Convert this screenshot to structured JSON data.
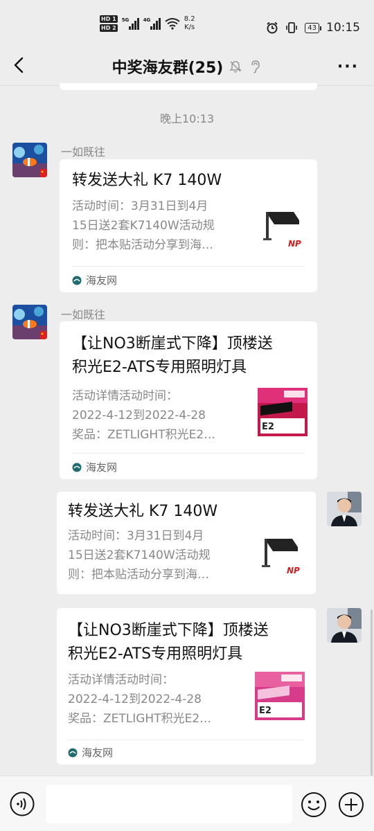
{
  "status_bar": {
    "hd1": "HD 1",
    "hd2": "HD 2",
    "net1": "5G",
    "net2": "4G",
    "speed_value": "8.2",
    "speed_unit": "K/s",
    "battery": "43",
    "time": "10:15"
  },
  "header": {
    "title": "中奖海友群(25)",
    "back_icon": "chevron-left-icon",
    "mute_icon": "bell-off-icon",
    "ear_icon": "earpiece-icon",
    "more_label": "···"
  },
  "timestamp": "晚上10:13",
  "messages": [
    {
      "sender": "一如既往",
      "side": "left",
      "title_lines": [
        "转发送大礼 K7 140W"
      ],
      "desc_lines": [
        "活动时间：3月31日到4月",
        "15日送2套K7140W活动规",
        "则：把本贴活动分享到海…"
      ],
      "thumb": "light-fixture",
      "thumb_text": "NP",
      "source": "海友网"
    },
    {
      "sender": "一如既往",
      "side": "left",
      "title_lines": [
        "【让NO3断崖式下降】顶楼送",
        "积光E2-ATS专用照明灯具"
      ],
      "desc_lines": [
        "活动详情活动时间：",
        "2022-4-12到2022-4-28",
        "奖品：ZETLIGHT积光E2…"
      ],
      "thumb": "e2-box",
      "thumb_text": "E2",
      "source": "海友网"
    },
    {
      "sender": "",
      "side": "right",
      "title_lines": [
        "转发送大礼 K7 140W"
      ],
      "desc_lines": [
        "活动时间：3月31日到4月",
        "15日送2套K7140W活动规",
        "则：把本贴活动分享到海…"
      ],
      "thumb": "light-fixture",
      "thumb_text": "NP",
      "source": ""
    },
    {
      "sender": "",
      "side": "right",
      "title_lines": [
        "【让NO3断崖式下降】顶楼送",
        "积光E2-ATS专用照明灯具"
      ],
      "desc_lines": [
        "活动详情活动时间：",
        "2022-4-12到2022-4-28",
        "奖品：ZETLIGHT积光E2…"
      ],
      "thumb": "e2-box",
      "thumb_text": "E2",
      "source": "海友网"
    }
  ],
  "bottom_bar": {
    "voice_icon": "voice-icon",
    "emoji_icon": "emoji-icon",
    "plus_icon": "plus-icon",
    "input_value": ""
  },
  "colors": {
    "background": "#ededed",
    "bubble": "#ffffff",
    "muted_text": "#888888"
  }
}
